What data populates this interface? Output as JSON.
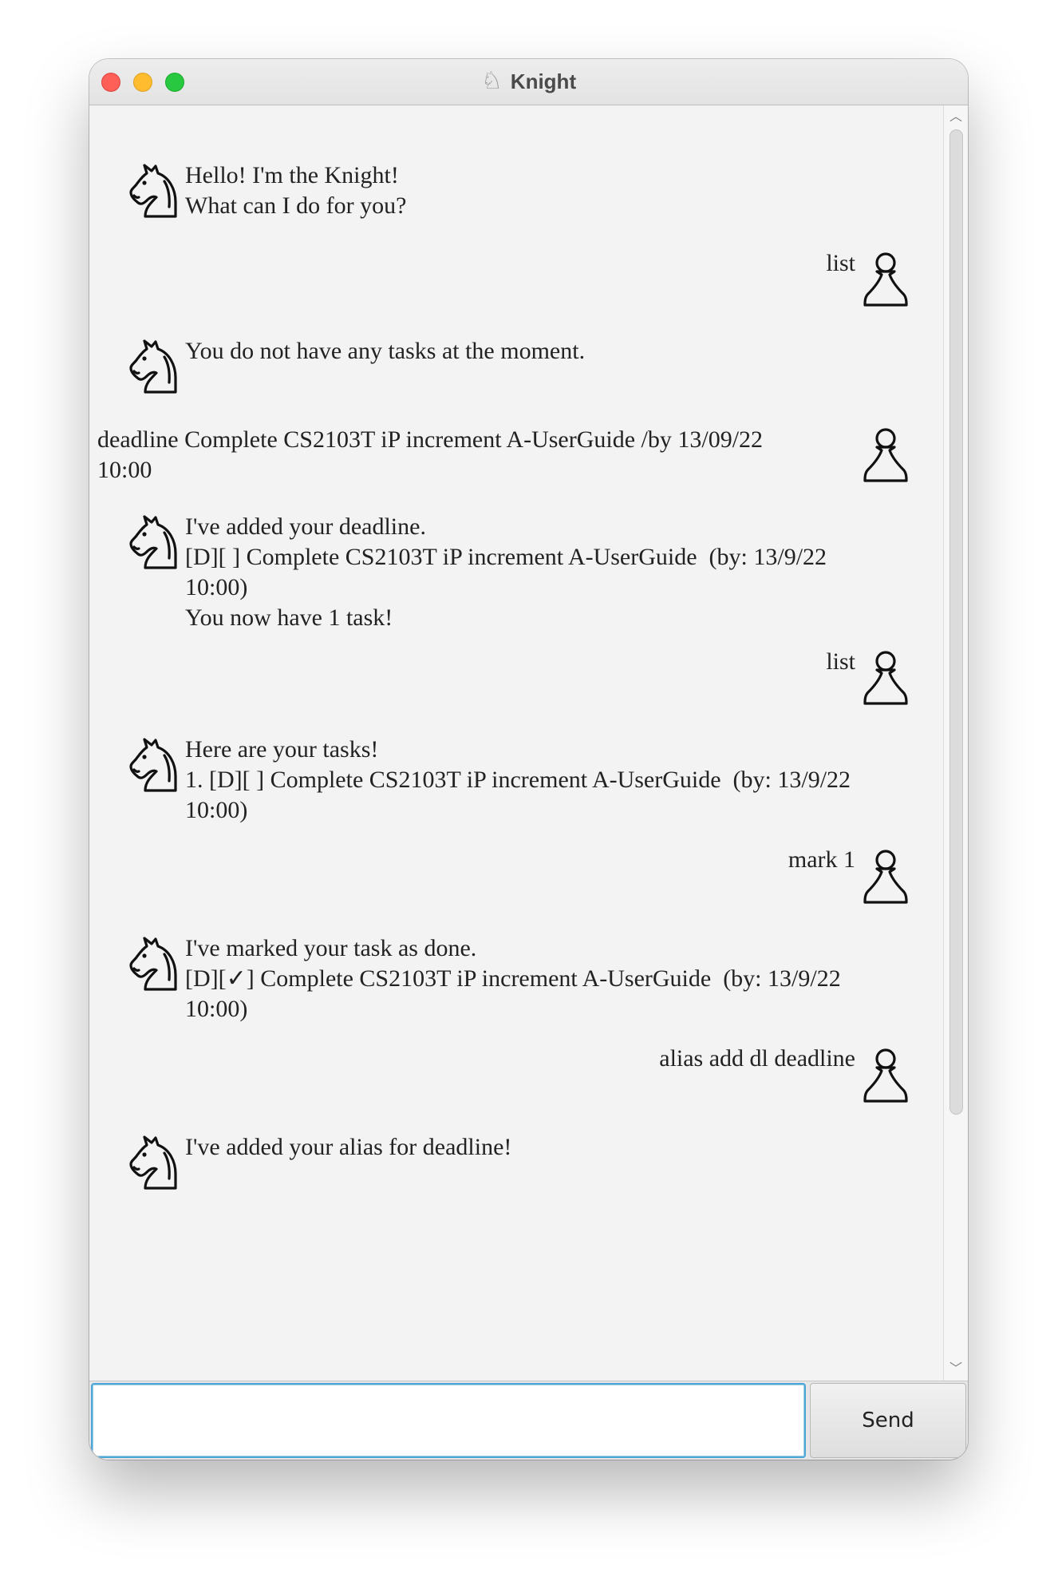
{
  "window": {
    "title": "Knight",
    "title_icon": "knight-icon"
  },
  "messages": [
    {
      "sender": "bot",
      "text": "Hello! I'm the Knight!\nWhat can I do for you?"
    },
    {
      "sender": "user",
      "text": "list"
    },
    {
      "sender": "bot",
      "text": "You do not have any tasks at the moment."
    },
    {
      "sender": "user",
      "text": "deadline Complete CS2103T iP increment A-UserGuide /by 13/09/22\n10:00"
    },
    {
      "sender": "bot",
      "text": "I've added your deadline.\n[D][ ] Complete CS2103T iP increment A-UserGuide  (by: 13/9/22\n10:00)\nYou now have 1 task!"
    },
    {
      "sender": "user",
      "text": "list"
    },
    {
      "sender": "bot",
      "text": "Here are your tasks!\n1. [D][ ] Complete CS2103T iP increment A-UserGuide  (by: 13/9/22\n10:00)"
    },
    {
      "sender": "user",
      "text": "mark 1"
    },
    {
      "sender": "bot",
      "text": "I've marked your task as done.\n[D][✓] Complete CS2103T iP increment A-UserGuide  (by: 13/9/22\n10:00)"
    },
    {
      "sender": "user",
      "text": "alias add dl deadline"
    },
    {
      "sender": "bot",
      "text": "I've added your alias for deadline!"
    }
  ],
  "input": {
    "value": "",
    "placeholder": ""
  },
  "send_label": "Send",
  "icons": {
    "bot_avatar": "knight-icon",
    "user_avatar": "pawn-icon"
  },
  "colors": {
    "focus_border": "#4da6d8",
    "background": "#f3f3f3"
  }
}
